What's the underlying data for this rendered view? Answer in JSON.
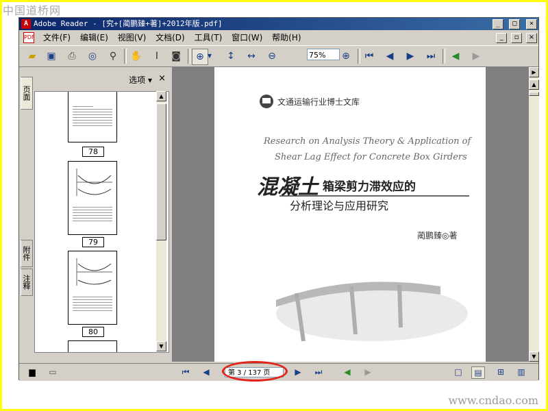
{
  "watermark": {
    "top": "中国道桥网",
    "bottom": "www.cndao.com"
  },
  "window": {
    "title": "Adobe Reader - [究+[蔺鹏臻+著]+2012年版.pdf]",
    "app_icon": "A",
    "minimize": "_",
    "maximize": "□",
    "close": "×",
    "doc_minimize": "_",
    "doc_restore": "▫",
    "doc_close": "×"
  },
  "menu": {
    "items": [
      "文件(F)",
      "编辑(E)",
      "视图(V)",
      "文档(D)",
      "工具(T)",
      "窗口(W)",
      "帮助(H)"
    ]
  },
  "toolbar": {
    "zoom_value": "75%",
    "icons": [
      "open-icon",
      "save-icon",
      "print-icon",
      "email-icon",
      "search-icon",
      "hand-icon",
      "select-icon",
      "snapshot-icon",
      "zoom-in-icon",
      "fit-page-icon",
      "fit-width-icon",
      "zoom-out-icon",
      "zoom-plus-icon",
      "first-page-icon",
      "prev-page-icon",
      "next-page-icon",
      "last-page-icon",
      "go-back-icon",
      "go-forward-icon"
    ]
  },
  "left_panel": {
    "tabs": [
      "页面",
      "附件",
      "注释"
    ],
    "options_label": "选项 ▾",
    "close": "×",
    "thumbs": [
      {
        "label": "78"
      },
      {
        "label": "79"
      },
      {
        "label": "80"
      }
    ]
  },
  "page_content": {
    "series": "文通运输行业博士文库",
    "en_title_1": "Research on Analysis Theory & Application of",
    "en_title_2": "Shear Lag Effect for Concrete Box Girders",
    "cn_title_big": "混凝土",
    "cn_title_rest": "箱梁剪力滞效应的",
    "cn_title_2": "分析理论与应用研究",
    "author": "蔺鹏臻◎著"
  },
  "status": {
    "page_indicator": "第 3 / 137 页"
  },
  "colors": {
    "accent": "#0a246a",
    "highlight": "#e2231a",
    "frame": "#ffff00"
  }
}
